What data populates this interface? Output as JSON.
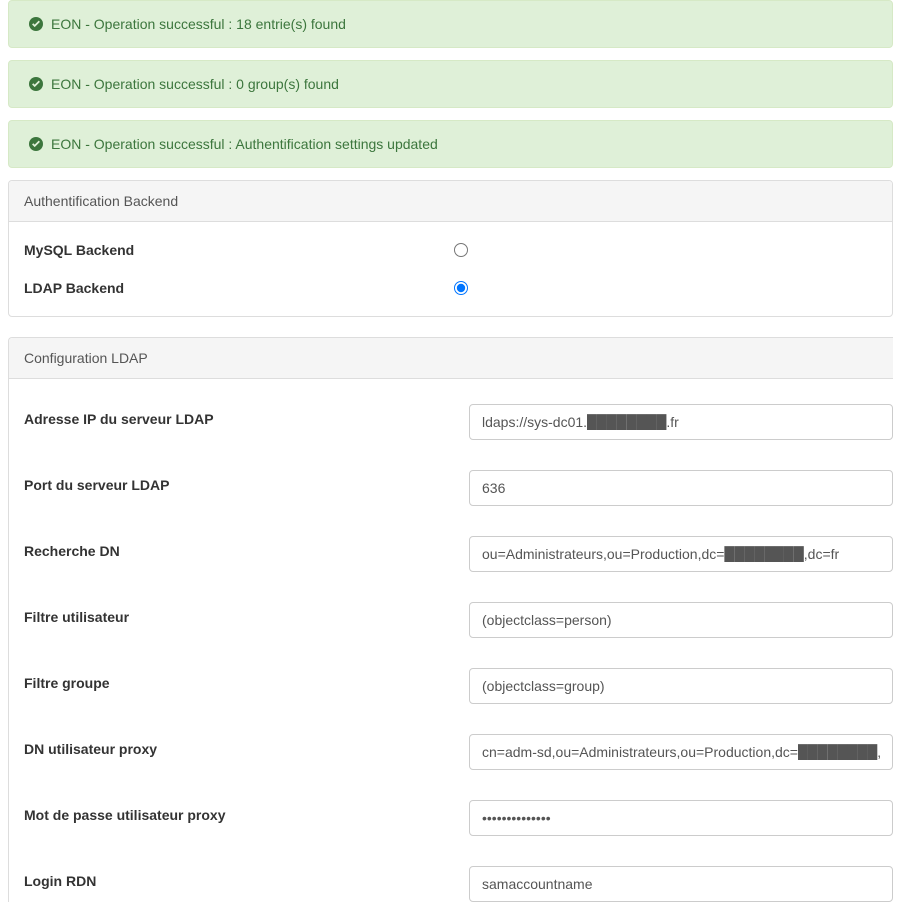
{
  "alerts": [
    "EON - Operation successful : 18 entrie(s) found",
    "EON - Operation successful : 0 group(s) found",
    "EON - Operation successful : Authentification settings updated"
  ],
  "authBackend": {
    "heading": "Authentification Backend",
    "mysql": {
      "label": "MySQL Backend",
      "checked": false
    },
    "ldap": {
      "label": "LDAP Backend",
      "checked": true
    }
  },
  "ldapConfig": {
    "heading": "Configuration LDAP",
    "fields": {
      "server_ip": {
        "label": "Adresse IP du serveur LDAP",
        "value": "ldaps://sys-dc01.████████.fr"
      },
      "server_port": {
        "label": "Port du serveur LDAP",
        "value": "636"
      },
      "search_dn": {
        "label": "Recherche DN",
        "value": "ou=Administrateurs,ou=Production,dc=████████,dc=fr"
      },
      "user_filter": {
        "label": "Filtre utilisateur",
        "value": "(objectclass=person)"
      },
      "group_filter": {
        "label": "Filtre groupe",
        "value": "(objectclass=group)"
      },
      "proxy_user_dn": {
        "label": "DN utilisateur proxy",
        "value": "cn=adm-sd,ou=Administrateurs,ou=Production,dc=████████,dc=fr"
      },
      "proxy_password": {
        "label": "Mot de passe utilisateur proxy",
        "value": "••••••••••••••"
      },
      "login_rdn": {
        "label": "Login RDN",
        "value": "samaccountname"
      }
    }
  }
}
